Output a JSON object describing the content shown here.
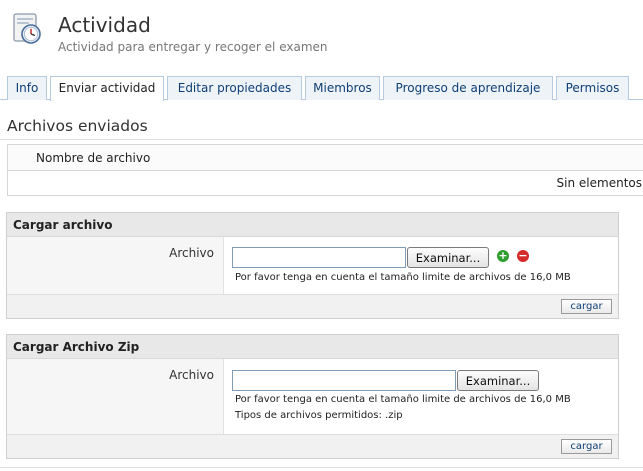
{
  "header": {
    "title": "Actividad",
    "subtitle": "Actividad para entregar y recoger el examen",
    "icon": "clock-document-icon"
  },
  "tabs": [
    {
      "label": "Info",
      "active": false
    },
    {
      "label": "Enviar actividad",
      "active": true
    },
    {
      "label": "Editar propiedades",
      "active": false
    },
    {
      "label": "Miembros",
      "active": false
    },
    {
      "label": "Progreso de aprendizaje",
      "active": false
    },
    {
      "label": "Permisos",
      "active": false
    }
  ],
  "submitted": {
    "title": "Archivos enviados",
    "column_header": "Nombre de archivo",
    "empty_text": "Sin elementos"
  },
  "upload_file": {
    "title": "Cargar archivo",
    "field_label": "Archivo",
    "browse_label": "Examinar...",
    "size_note": "Por favor tenga en cuenta el tamaño limite de archivos de 16,0 MB",
    "submit_label": "cargar"
  },
  "upload_zip": {
    "title": "Cargar Archivo Zip",
    "field_label": "Archivo",
    "browse_label": "Examinar...",
    "size_note": "Por favor tenga en cuenta el tamaño limite de archivos de 16,0 MB",
    "types_note": "Tipos de archivos permitidos: .zip",
    "submit_label": "cargar"
  },
  "colors": {
    "accent": "#0f3f75",
    "tab_bg": "#eef3f8",
    "panel_header": "#e8e8e8",
    "add": "#2e9e2e",
    "remove": "#d42a2a"
  }
}
